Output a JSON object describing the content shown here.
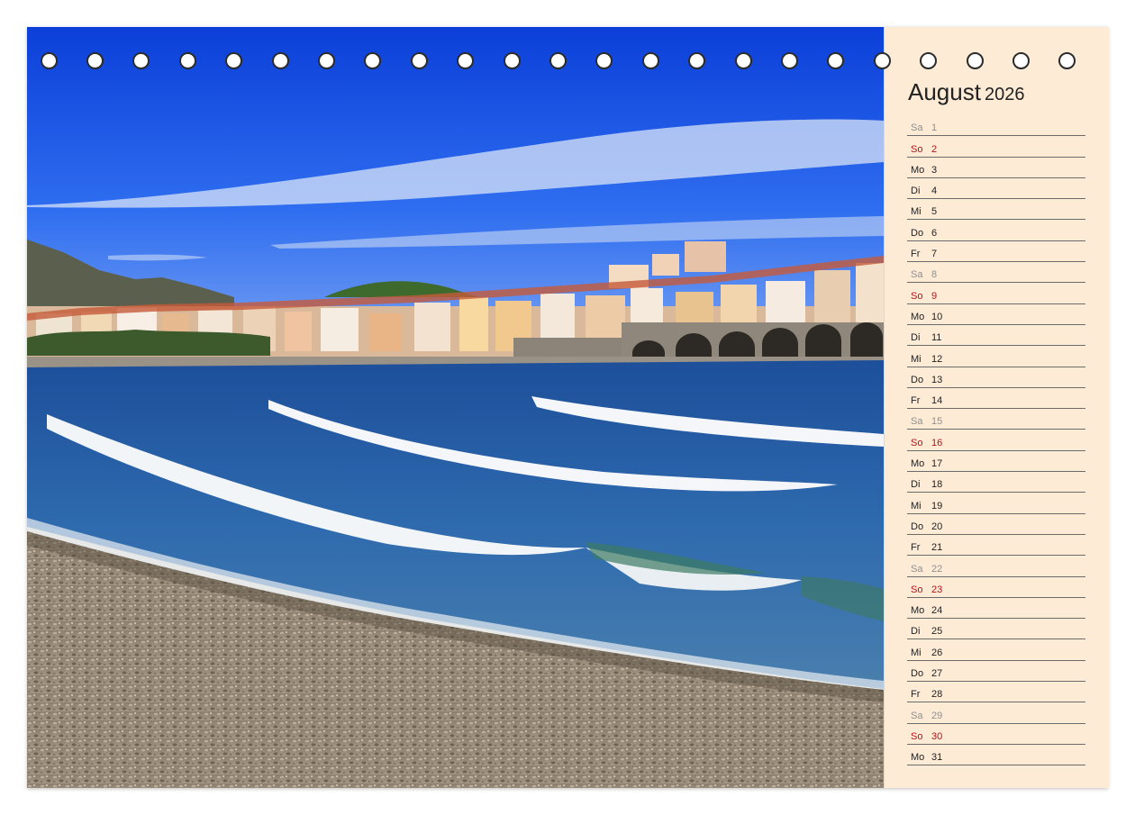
{
  "calendar": {
    "month": "August",
    "year": "2026",
    "days": [
      {
        "name": "Sa",
        "num": "1",
        "kind": "sat"
      },
      {
        "name": "So",
        "num": "2",
        "kind": "sun"
      },
      {
        "name": "Mo",
        "num": "3",
        "kind": "week"
      },
      {
        "name": "Di",
        "num": "4",
        "kind": "week"
      },
      {
        "name": "Mi",
        "num": "5",
        "kind": "week"
      },
      {
        "name": "Do",
        "num": "6",
        "kind": "week"
      },
      {
        "name": "Fr",
        "num": "7",
        "kind": "week"
      },
      {
        "name": "Sa",
        "num": "8",
        "kind": "sat"
      },
      {
        "name": "So",
        "num": "9",
        "kind": "sun"
      },
      {
        "name": "Mo",
        "num": "10",
        "kind": "week"
      },
      {
        "name": "Di",
        "num": "11",
        "kind": "week"
      },
      {
        "name": "Mi",
        "num": "12",
        "kind": "week"
      },
      {
        "name": "Do",
        "num": "13",
        "kind": "week"
      },
      {
        "name": "Fr",
        "num": "14",
        "kind": "week"
      },
      {
        "name": "Sa",
        "num": "15",
        "kind": "sat"
      },
      {
        "name": "So",
        "num": "16",
        "kind": "sun"
      },
      {
        "name": "Mo",
        "num": "17",
        "kind": "week"
      },
      {
        "name": "Di",
        "num": "18",
        "kind": "week"
      },
      {
        "name": "Mi",
        "num": "19",
        "kind": "week"
      },
      {
        "name": "Do",
        "num": "20",
        "kind": "week"
      },
      {
        "name": "Fr",
        "num": "21",
        "kind": "week"
      },
      {
        "name": "Sa",
        "num": "22",
        "kind": "sat"
      },
      {
        "name": "So",
        "num": "23",
        "kind": "sun"
      },
      {
        "name": "Mo",
        "num": "24",
        "kind": "week"
      },
      {
        "name": "Di",
        "num": "25",
        "kind": "week"
      },
      {
        "name": "Mi",
        "num": "26",
        "kind": "week"
      },
      {
        "name": "Do",
        "num": "27",
        "kind": "week"
      },
      {
        "name": "Fr",
        "num": "28",
        "kind": "week"
      },
      {
        "name": "Sa",
        "num": "29",
        "kind": "sat"
      },
      {
        "name": "So",
        "num": "30",
        "kind": "sun"
      },
      {
        "name": "Mo",
        "num": "31",
        "kind": "week"
      }
    ]
  },
  "colors": {
    "panel_bg": "#fdebd6",
    "sunday": "#b3141a",
    "saturday": "#8f8f8f",
    "weekday": "#222222"
  }
}
